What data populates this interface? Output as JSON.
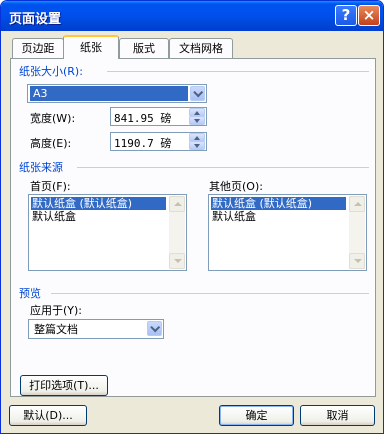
{
  "window": {
    "title": "页面设置",
    "help_label": "?",
    "close_label": "×"
  },
  "tabs": [
    {
      "label": "页边距",
      "active": false
    },
    {
      "label": "纸张",
      "active": true
    },
    {
      "label": "版式",
      "active": false
    },
    {
      "label": "文档网格",
      "active": false
    }
  ],
  "paper_size": {
    "section_label": "纸张大小(R):",
    "selected": "A3",
    "width_label": "宽度(W):",
    "width_value": "841.95 磅",
    "height_label": "高度(E):",
    "height_value": "1190.7 磅"
  },
  "paper_source": {
    "section_label": "纸张来源",
    "first_page_label": "首页(F):",
    "first_page_items": [
      "默认纸盒 (默认纸盒)",
      "默认纸盒"
    ],
    "other_pages_label": "其他页(O):",
    "other_pages_items": [
      "默认纸盒 (默认纸盒)",
      "默认纸盒"
    ]
  },
  "preview": {
    "section_label": "预览",
    "apply_to_label": "应用于(Y):",
    "apply_to_value": "整篇文档",
    "print_options_label": "打印选项(T)..."
  },
  "footer": {
    "default_label": "默认(D)...",
    "ok_label": "确定",
    "cancel_label": "取消"
  },
  "colors": {
    "title_bar": "#0050ee",
    "section_label": "#0046d5",
    "selection": "#316ac5",
    "dialog_bg": "#ece9d8"
  }
}
